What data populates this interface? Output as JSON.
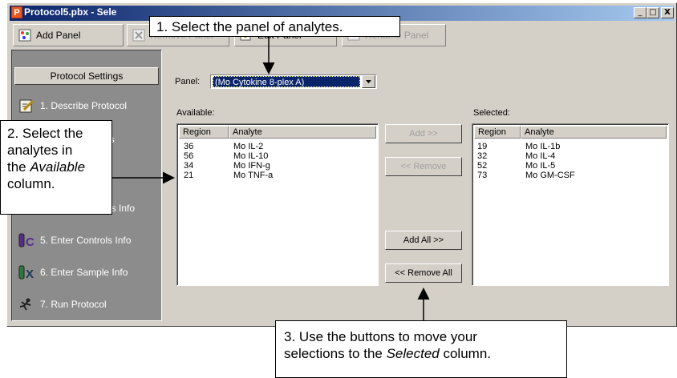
{
  "window": {
    "title": "Protocol5.pbx - Sele",
    "app_letter": "P",
    "buttons": [
      "_",
      "□",
      "X"
    ]
  },
  "toolbar": {
    "add_panel": "Add Panel",
    "remove_panel": "Remove Panel",
    "edit_panel": "Edit Panel",
    "rename_panel": "Rename Panel"
  },
  "sidebar": {
    "header": "Protocol Settings",
    "items": [
      {
        "label": "1. Describe Protocol"
      },
      {
        "label": "es"
      },
      {
        "label": "rds Info"
      },
      {
        "label": "5. Enter Controls Info"
      },
      {
        "label": "6. Enter Sample Info"
      },
      {
        "label": "7. Run Protocol"
      }
    ]
  },
  "panel": {
    "label": "Panel:",
    "value": "(Mo Cytokine 8-plex A)"
  },
  "available": {
    "label": "Available:",
    "columns": [
      "Region",
      "Analyte"
    ],
    "rows": [
      {
        "region": "36",
        "analyte": "Mo IL-2"
      },
      {
        "region": "56",
        "analyte": "Mo IL-10"
      },
      {
        "region": "34",
        "analyte": "Mo IFN-g"
      },
      {
        "region": "21",
        "analyte": "Mo TNF-a"
      }
    ]
  },
  "selected": {
    "label": "Selected:",
    "columns": [
      "Region",
      "Analyte"
    ],
    "rows": [
      {
        "region": "19",
        "analyte": "Mo IL-1b"
      },
      {
        "region": "32",
        "analyte": "Mo IL-4"
      },
      {
        "region": "52",
        "analyte": "Mo IL-5"
      },
      {
        "region": "73",
        "analyte": "Mo GM-CSF"
      }
    ]
  },
  "buttons": {
    "add": "Add >>",
    "remove": "<< Remove",
    "add_all": "Add All >>",
    "remove_all": "<< Remove All"
  },
  "callouts": {
    "c1": "1. Select the panel of analytes.",
    "c2_line1": "2. Select the",
    "c2_line2": "analytes in",
    "c2_line3_pre": "the ",
    "c2_line3_em": "Available",
    "c2_line4": "column.",
    "c3_line1": "3. Use the buttons to move your",
    "c3_line2_pre": "selections to the ",
    "c3_line2_em": "Selected",
    "c3_line2_post": " column."
  }
}
